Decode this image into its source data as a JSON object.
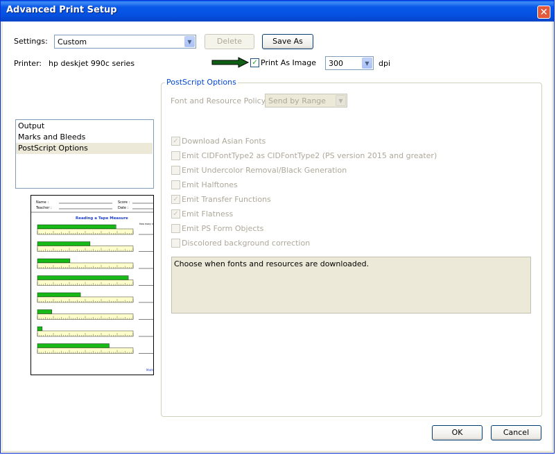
{
  "window": {
    "title": "Advanced Print Setup",
    "close_glyph": "✕"
  },
  "settings": {
    "label": "Settings:",
    "value": "Custom",
    "delete_label": "Delete",
    "save_as_label": "Save As"
  },
  "printer": {
    "label": "Printer:",
    "name": "hp deskjet 990c series",
    "print_as_image_label": "Print As Image",
    "print_as_image_checked": true,
    "dpi_value": "300",
    "dpi_unit": "dpi"
  },
  "nav": {
    "items": [
      "Output",
      "Marks and Bleeds",
      "PostScript Options"
    ],
    "selected_index": 2
  },
  "postscript": {
    "group_title": "PostScript Options",
    "policy_label": "Font and Resource Policy:",
    "policy_value": "Send by Range",
    "options": [
      {
        "label": "Download Asian Fonts",
        "checked": true
      },
      {
        "label": "Emit CIDFontType2 as CIDFontType2 (PS version 2015 and greater)",
        "checked": false
      },
      {
        "label": "Emit Undercolor Removal/Black Generation",
        "checked": false
      },
      {
        "label": "Emit Halftones",
        "checked": false
      },
      {
        "label": "Emit Transfer Functions",
        "checked": true
      },
      {
        "label": "Emit Flatness",
        "checked": true
      },
      {
        "label": "Emit PS Form Objects",
        "checked": false
      },
      {
        "label": "Discolored background correction",
        "checked": false
      }
    ],
    "description": "Choose when fonts and resources are downloaded."
  },
  "preview": {
    "name_label": "Name :",
    "teacher_label": "Teacher :",
    "score_label": "Score :",
    "date_label": "Date :",
    "worksheet_title": "Reading a Tape Measure",
    "question_label": "How many in",
    "measures": [
      0.82,
      0.55,
      0.34,
      0.95,
      0.45,
      0.15,
      0.05,
      0.75
    ],
    "footer_text": "Math",
    "bar_color": "#16b916",
    "ruler_color": "#ffffcc"
  },
  "footer": {
    "ok_label": "OK",
    "cancel_label": "Cancel"
  },
  "colors": {
    "title_bar": "#0a5ff0",
    "group_title": "#0046d5",
    "arrow": "#0f5f14"
  }
}
